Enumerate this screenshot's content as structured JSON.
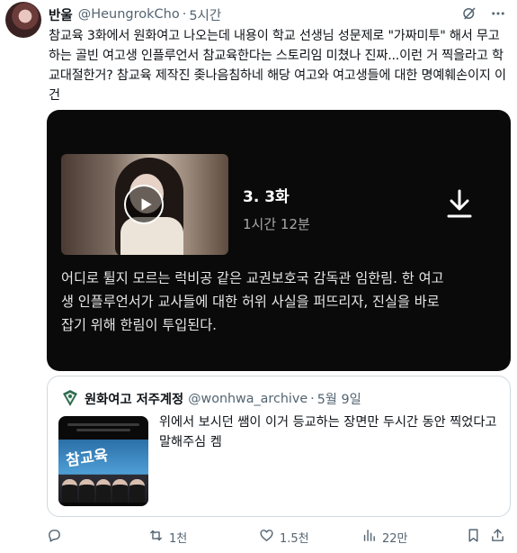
{
  "tweet": {
    "author_name": "반울",
    "handle": "@HeungrokCho",
    "separator": "·",
    "time": "5시간",
    "text": "참교육 3화에서 원화여고 나오는데 내용이 학교 선생님 성문제로 \"가짜미투\" 해서 무고하는 골빈 여고생 인플루언서 참교육한다는 스토리임 미쳤나 진짜...이런 거 찍을라고 학교대절한거? 참교육 제작진 좆나음침하네 해당 여고와 여고생들에 대한 명예훼손이지 이건"
  },
  "video_card": {
    "episode_title": "3. 3화",
    "duration": "1시간 12분",
    "synopsis": "어디로 튈지 모르는 럭비공 같은 교권보호국 감독관 임한림. 한 여고생 인플루언서가 교사들에 대한 허위 사실을 퍼뜨리자, 진실을 바로잡기 위해 한림이 투입된다."
  },
  "quote": {
    "author_name": "원화여고 저주계정",
    "handle": "@wonhwa_archive",
    "separator": "·",
    "date": "5월 9일",
    "text": "위에서 보시던 쌤이 이거 등교하는 장면만 두시간 동안 찍었다고 말해주심 켐",
    "poster_title": "참교육"
  },
  "actions": {
    "replies": "",
    "retweets": "1천",
    "likes": "1.5천",
    "views": "22만"
  },
  "icons": {
    "header": [
      "grok-icon",
      "more-icon"
    ],
    "actions": [
      "reply-icon",
      "retweet-icon",
      "like-icon",
      "views-icon",
      "bookmark-icon",
      "share-icon"
    ]
  },
  "colors": {
    "text": "#0f1419",
    "secondary": "#536471",
    "border": "#cfd9de",
    "card_bg": "#0a0a0a"
  }
}
